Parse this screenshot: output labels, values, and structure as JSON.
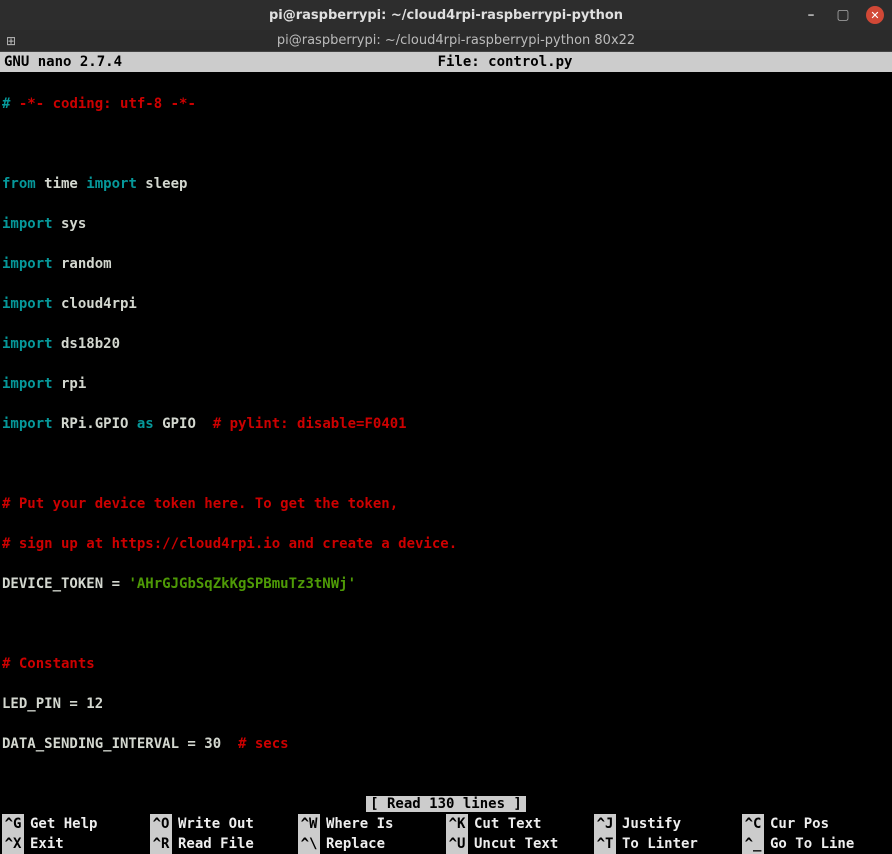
{
  "window": {
    "title": "pi@raspberrypi: ~/cloud4rpi-raspberrypi-python",
    "tab_title": "pi@raspberrypi: ~/cloud4rpi-raspberrypi-python 80x22"
  },
  "nano": {
    "app": "GNU  nano  2.7.4",
    "file_label": "File: control.py",
    "status": "[ Read 130 lines ]"
  },
  "code": {
    "l1a": "#",
    "l1b": " -*- coding: utf-8 -*-",
    "l3a": "from",
    "l3b": " time ",
    "l3c": "import",
    "l3d": " sleep",
    "l4a": "import",
    "l4b": " sys",
    "l5a": "import",
    "l5b": " random",
    "l6a": "import",
    "l6b": " cloud4rpi",
    "l7a": "import",
    "l7b": " ds18b20",
    "l8a": "import",
    "l8b": " rpi",
    "l9a": "import",
    "l9b": " RPi.GPIO ",
    "l9c": "as",
    "l9d": " GPIO  ",
    "l9e": "# pylint: disable=F0401",
    "l11": "# Put your device token here. To get the token,",
    "l12": "# sign up at https://cloud4rpi.io and create a device.",
    "l13a": "DEVICE_TOKEN = ",
    "l13b": "'AHrGJGbSqZkKgSPBmuTz3tNWj'",
    "l15": "# Constants",
    "l16": "LED_PIN = 12",
    "l17a": "DATA_SENDING_INTERVAL = 30  ",
    "l17b": "# secs"
  },
  "shortcuts": {
    "r1": [
      {
        "key": "^G",
        "label": "Get Help"
      },
      {
        "key": "^O",
        "label": "Write Out"
      },
      {
        "key": "^W",
        "label": "Where Is"
      },
      {
        "key": "^K",
        "label": "Cut Text"
      },
      {
        "key": "^J",
        "label": "Justify"
      },
      {
        "key": "^C",
        "label": "Cur Pos"
      }
    ],
    "r2": [
      {
        "key": "^X",
        "label": "Exit"
      },
      {
        "key": "^R",
        "label": "Read File"
      },
      {
        "key": "^\\",
        "label": "Replace"
      },
      {
        "key": "^U",
        "label": "Uncut Text"
      },
      {
        "key": "^T",
        "label": "To Linter"
      },
      {
        "key": "^_",
        "label": "Go To Line"
      }
    ]
  }
}
